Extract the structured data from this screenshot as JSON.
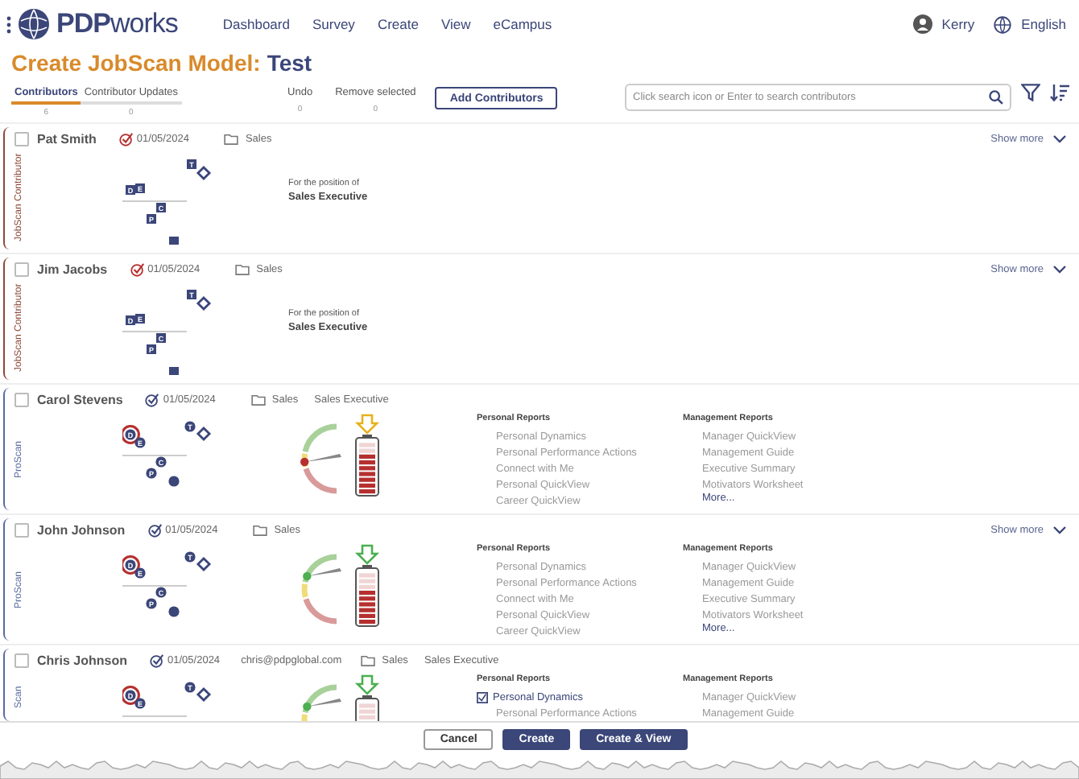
{
  "header": {
    "brand": {
      "bold": "PDP",
      "light": "works"
    },
    "nav": [
      "Dashboard",
      "Survey",
      "Create",
      "View",
      "eCampus"
    ],
    "user": "Kerry",
    "language": "English"
  },
  "title": {
    "prefix": "Create JobScan Model:",
    "name": "Test"
  },
  "tabs": [
    {
      "label": "Contributors",
      "count": "6",
      "selected": true
    },
    {
      "label": "Contributor Updates",
      "count": "0",
      "selected": false
    }
  ],
  "actions": [
    {
      "label": "Undo",
      "count": "0"
    },
    {
      "label": "Remove selected",
      "count": "0"
    }
  ],
  "add_button": "Add Contributors",
  "search": {
    "placeholder": "Click search icon or Enter to search contributors"
  },
  "contributors": [
    {
      "kind": "jobscan",
      "side_label": "JobScan Contributor",
      "name": "Pat Smith",
      "checked": false,
      "date": "01/05/2024",
      "department": "Sales",
      "show_more": "Show more",
      "pattern": [
        {
          "label": "T",
          "highlighted": false
        },
        {
          "label": "D",
          "highlighted": false
        },
        {
          "label": "E",
          "highlighted": false
        },
        {
          "label": "C",
          "highlighted": false
        },
        {
          "label": "P",
          "highlighted": false
        }
      ],
      "position_caption": "For the position of",
      "position": "Sales Executive"
    },
    {
      "kind": "jobscan",
      "side_label": "JobScan Contributor",
      "name": "Jim Jacobs",
      "checked": false,
      "date": "01/05/2024",
      "department": "Sales",
      "show_more": "Show more",
      "pattern": [
        {
          "label": "T",
          "highlighted": false
        },
        {
          "label": "D",
          "highlighted": false
        },
        {
          "label": "E",
          "highlighted": false
        },
        {
          "label": "C",
          "highlighted": false
        },
        {
          "label": "P",
          "highlighted": false
        }
      ],
      "position_caption": "For the position of",
      "position": "Sales Executive"
    },
    {
      "kind": "proscan",
      "side_label": "ProScan",
      "name": "Carol Stevens",
      "checked": false,
      "date": "01/05/2024",
      "department": "Sales",
      "job_title": "Sales Executive",
      "pattern": [
        {
          "label": "T",
          "highlighted": false
        },
        {
          "label": "D",
          "highlighted": true
        },
        {
          "label": "E",
          "highlighted": false
        },
        {
          "label": "C",
          "highlighted": false
        },
        {
          "label": "P",
          "highlighted": false
        }
      ],
      "gauge": {
        "level": 0.45,
        "color": "#b5302f"
      },
      "battery": {
        "level": 0.8,
        "color": "#e6b21c"
      },
      "personal_reports": {
        "heading": "Personal Reports",
        "items": [
          {
            "label": "Personal Dynamics",
            "checked": false
          },
          {
            "label": "Personal Performance Actions",
            "checked": false
          },
          {
            "label": "Connect with Me",
            "checked": false
          },
          {
            "label": "Personal QuickView",
            "checked": false
          },
          {
            "label": "Career QuickView",
            "checked": false
          }
        ]
      },
      "management_reports": {
        "heading": "Management Reports",
        "items": [
          {
            "label": "Manager QuickView",
            "checked": false
          },
          {
            "label": "Management Guide",
            "checked": false
          },
          {
            "label": "Executive Summary",
            "checked": false
          },
          {
            "label": "Motivators Worksheet",
            "checked": false
          }
        ],
        "more": "More..."
      }
    },
    {
      "kind": "proscan",
      "side_label": "ProScan",
      "name": "John Johnson",
      "checked": false,
      "date": "01/05/2024",
      "department": "Sales",
      "show_more": "Show more",
      "pattern": [
        {
          "label": "T",
          "highlighted": false
        },
        {
          "label": "D",
          "highlighted": true
        },
        {
          "label": "E",
          "highlighted": false
        },
        {
          "label": "C",
          "highlighted": false
        },
        {
          "label": "P",
          "highlighted": false
        }
      ],
      "gauge": {
        "level": 0.7,
        "color": "#4caf50"
      },
      "battery": {
        "level": 0.7,
        "color": "#4caf50"
      },
      "personal_reports": {
        "heading": "Personal Reports",
        "items": [
          {
            "label": "Personal Dynamics",
            "checked": false
          },
          {
            "label": "Personal Performance Actions",
            "checked": false
          },
          {
            "label": "Connect with Me",
            "checked": false
          },
          {
            "label": "Personal QuickView",
            "checked": false
          },
          {
            "label": "Career QuickView",
            "checked": false
          }
        ]
      },
      "management_reports": {
        "heading": "Management Reports",
        "items": [
          {
            "label": "Manager QuickView",
            "checked": false
          },
          {
            "label": "Management Guide",
            "checked": false
          },
          {
            "label": "Executive Summary",
            "checked": false
          },
          {
            "label": "Motivators Worksheet",
            "checked": false
          }
        ],
        "more": "More..."
      }
    },
    {
      "kind": "proscan",
      "side_label": "Scan",
      "name": "Chris Johnson",
      "checked": false,
      "date": "01/05/2024",
      "email": "chris@pdpglobal.com",
      "department": "Sales",
      "job_title": "Sales Executive",
      "pattern": [
        {
          "label": "T",
          "highlighted": false
        },
        {
          "label": "D",
          "highlighted": true
        },
        {
          "label": "E",
          "highlighted": false
        }
      ],
      "gauge": {
        "level": 0.7,
        "color": "#4caf50"
      },
      "battery": {
        "level": 0.1,
        "color": "#4caf50"
      },
      "personal_reports": {
        "heading": "Personal Reports",
        "items": [
          {
            "label": "Personal Dynamics",
            "checked": true
          },
          {
            "label": "Personal Performance Actions",
            "checked": false
          }
        ]
      },
      "management_reports": {
        "heading": "Management Reports",
        "items": [
          {
            "label": "Manager QuickView",
            "checked": false
          },
          {
            "label": "Management Guide",
            "checked": false
          }
        ]
      }
    }
  ],
  "footer": [
    {
      "label": "Cancel",
      "kind": "secondary"
    },
    {
      "label": "Create",
      "kind": "primary"
    },
    {
      "label": "Create & View",
      "kind": "primary"
    }
  ]
}
